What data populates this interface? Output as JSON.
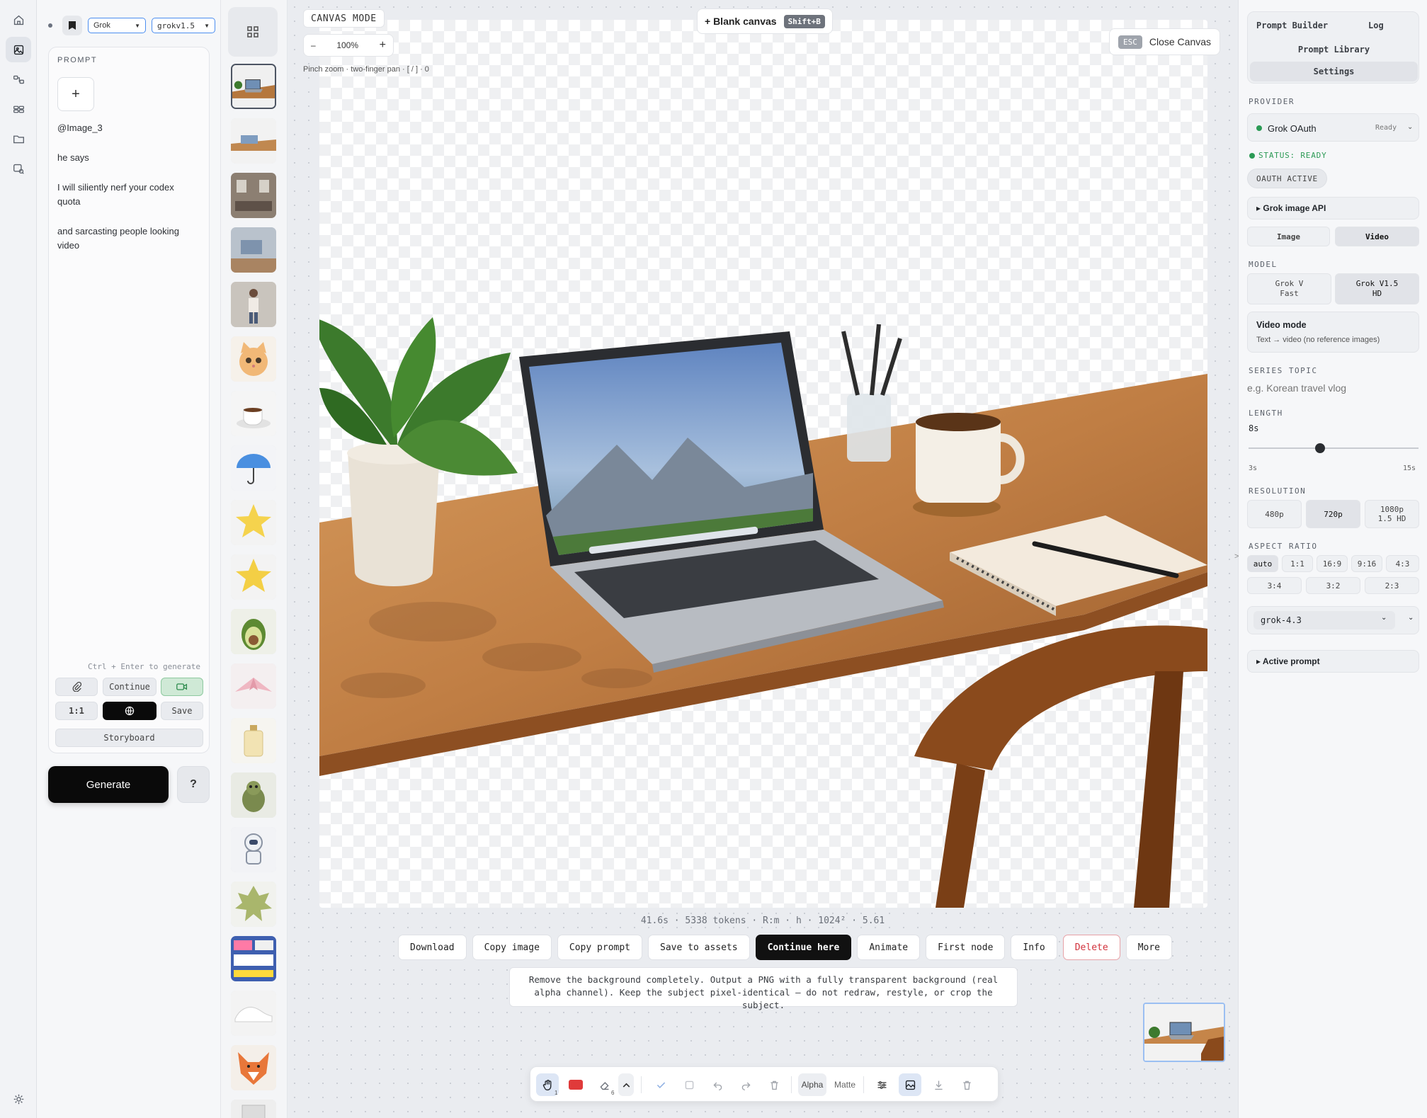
{
  "selects": {
    "provider": "Grok",
    "model": "grokv1.5"
  },
  "prompt": {
    "label": "PROMPT",
    "add": "+",
    "lines": [
      "@Image_3",
      "he says",
      "I will siliently nerf your codex quota",
      "and sarcasting people looking video"
    ],
    "hint": "Ctrl + Enter to generate",
    "continue": "Continue",
    "ratio": "1:1",
    "save": "Save",
    "storyboard": "Storyboard",
    "generate": "Generate",
    "help": "?"
  },
  "canvas": {
    "mode": "CANVAS MODE",
    "zoom": "100%",
    "zoom_out": "–",
    "zoom_in": "+",
    "pinch_hint": "Pinch zoom · two-finger pan · [ / ] · 0",
    "blank_canvas": "+  Blank canvas",
    "blank_shortcut": "Shift+B",
    "esc": "ESC",
    "close": "Close Canvas",
    "meta": "41.6s · 5338 tokens · R:m · h · 1024² · 5.61",
    "actions": [
      "Download",
      "Copy image",
      "Copy prompt",
      "Save to assets",
      "Continue here",
      "Animate",
      "First node",
      "Info",
      "Delete",
      "More"
    ],
    "prompt_note": "Remove the background completely. Output a PNG with a fully transparent background (real alpha channel). Keep the subject pixel-identical — do not redraw, restyle, or crop the subject.",
    "toolbar": {
      "hand_count": "1",
      "eraser_count": "6",
      "alpha": "Alpha",
      "matte": "Matte"
    }
  },
  "settings": {
    "tabs": [
      "Prompt Builder",
      "Log",
      "Prompt Library",
      "Settings"
    ],
    "provider_label": "PROVIDER",
    "provider_name": "Grok OAuth",
    "provider_state": "Ready",
    "status": "STATUS: READY",
    "oauth": "OAUTH ACTIVE",
    "api_section": "▸ Grok image API",
    "media": [
      "Image",
      "Video"
    ],
    "model_label": "MODEL",
    "models": [
      {
        "line1": "Grok V",
        "line2": "Fast"
      },
      {
        "line1": "Grok V1.5",
        "line2": "HD"
      }
    ],
    "video_mode_title": "Video mode",
    "video_mode_desc": "Text → video (no reference images)",
    "series_label": "SERIES TOPIC",
    "series_placeholder": "e.g. Korean travel vlog",
    "length_label": "LENGTH",
    "length_value": "8s",
    "length_level": 0.42,
    "length_min": "3s",
    "length_max": "15s",
    "resolution_label": "RESOLUTION",
    "resolutions": [
      {
        "line1": "480p",
        "line2": ""
      },
      {
        "line1": "720p",
        "line2": ""
      },
      {
        "line1": "1080p",
        "line2": "1.5 HD"
      }
    ],
    "aspect_label": "ASPECT RATIO",
    "aspects": [
      "auto",
      "1:1",
      "16:9",
      "9:16",
      "4:3",
      "3:4",
      "3:2",
      "2:3"
    ],
    "llm_model": "grok-4.3",
    "active_prompt": "▸ Active prompt",
    "collapse": ">"
  }
}
